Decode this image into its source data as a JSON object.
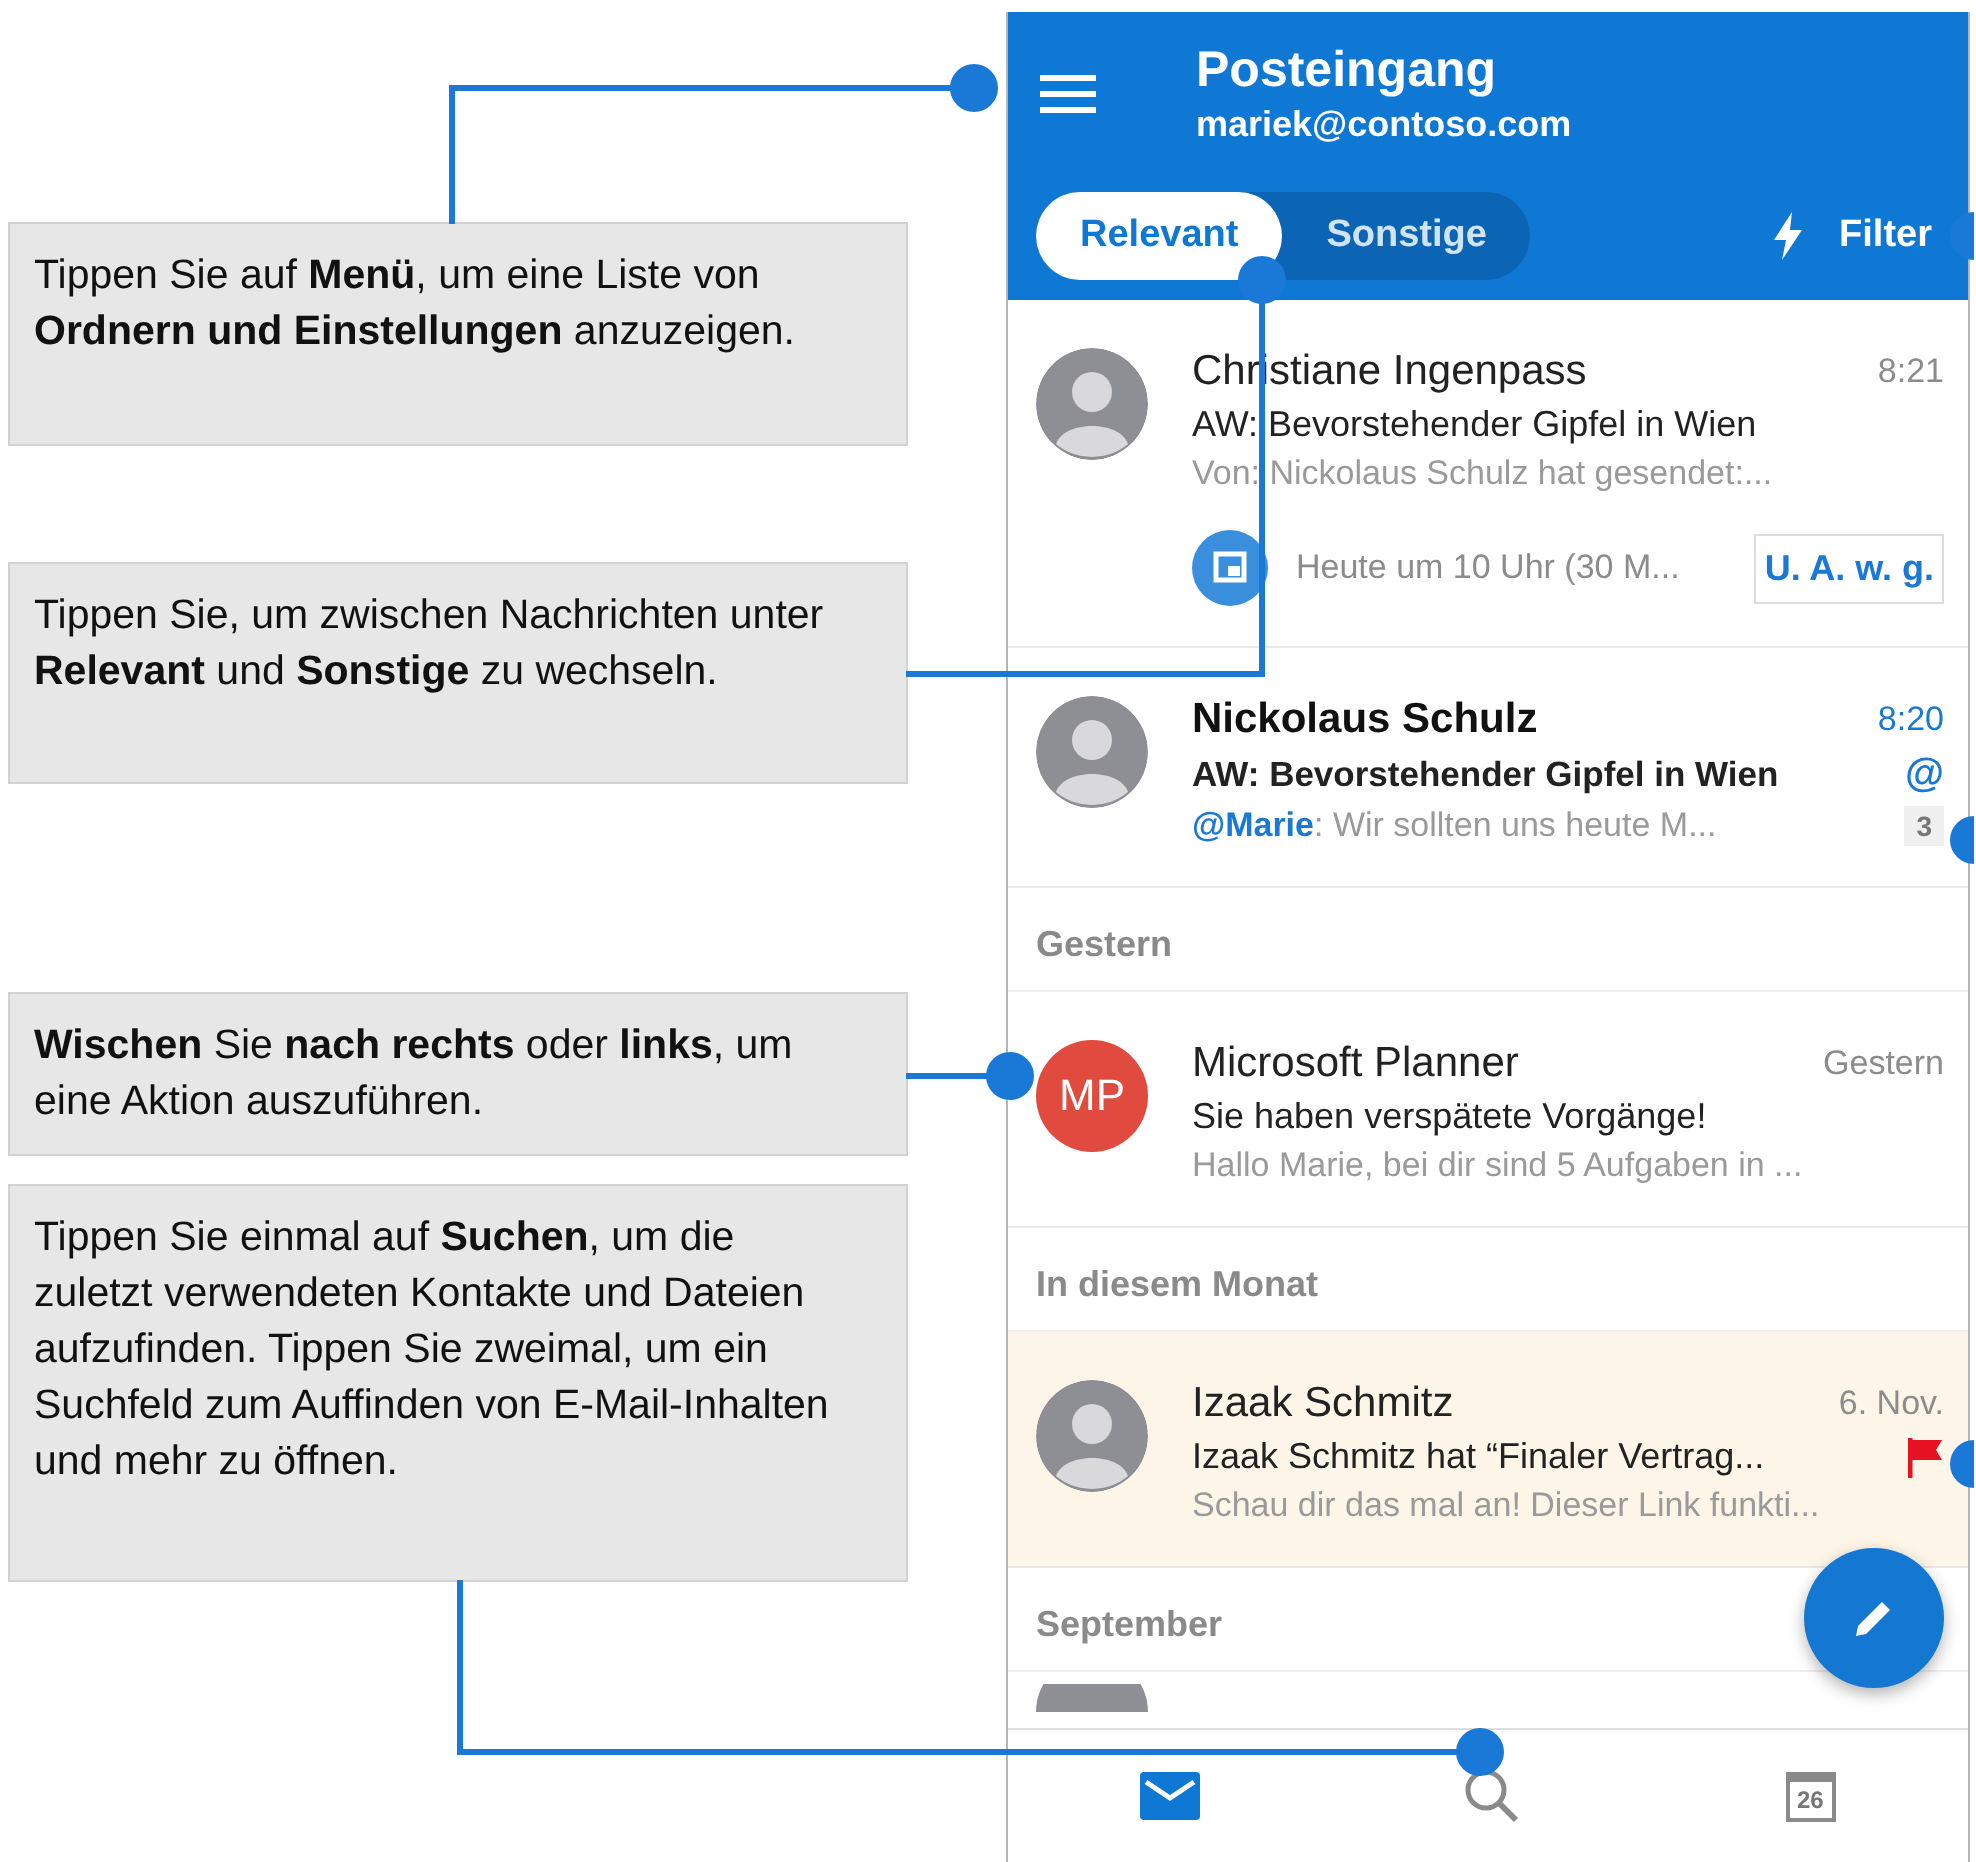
{
  "callouts": [
    {
      "text": "Tippen Sie auf **Menü**, um eine Liste von **Ordnern und Einstellungen** anzuzeigen."
    },
    {
      "text": "Tippen Sie, um zwischen Nachrichten unter **Relevant** und **Sonstige** zu wechseln."
    },
    {
      "text": "**Wischen** Sie **nach rechts** oder **links**, um eine Aktion auszuführen."
    },
    {
      "text": "Tippen Sie einmal auf **Suchen**, um die zuletzt verwendeten Kontakte und Dateien aufzufinden. Tippen Sie zweimal, um ein Suchfeld zum Auffinden von E-Mail-Inhalten und mehr zu öffnen."
    }
  ],
  "header": {
    "title": "Posteingang",
    "account": "mariek@contoso.com",
    "filter": "Filter",
    "tabs": [
      {
        "label": "Relevant",
        "selected": true
      },
      {
        "label": "Sonstige",
        "selected": false
      }
    ]
  },
  "sections": [
    {
      "messages": [
        {
          "sender": "Christiane Ingenpass",
          "time": "8:21",
          "subject": "AW: Bevorstehender Gipfel in Wien",
          "preview": "Von: Nickolaus Schulz hat gesendet:...",
          "unread": false,
          "flagged": false,
          "avatar": {
            "kind": "photo"
          },
          "event": {
            "text": "Heute um 10 Uhr (30 M...",
            "action": "U. A. w. g."
          }
        },
        {
          "sender": "Nickolaus Schulz",
          "time": "8:20",
          "subject": "AW: Bevorstehender Gipfel in Wien",
          "mention": "@Marie",
          "preview": ": Wir sollten uns heute M...",
          "unread": true,
          "flagged": false,
          "at_sign": "@",
          "count": "3",
          "avatar": {
            "kind": "photo"
          }
        }
      ]
    },
    {
      "heading": "Gestern",
      "messages": [
        {
          "sender": "Microsoft Planner",
          "time": "Gestern",
          "subject": "Sie haben verspätete Vorgänge!",
          "preview": "Hallo Marie, bei dir sind 5 Aufgaben in ...",
          "unread": false,
          "flagged": false,
          "avatar": {
            "kind": "initials",
            "initials": "MP",
            "color": "#e04a3f"
          }
        }
      ]
    },
    {
      "heading": "In diesem Monat",
      "messages": [
        {
          "sender": "Izaak Schmitz",
          "time": "6. Nov.",
          "subject": "Izaak Schmitz hat “Finaler Vertrag...",
          "preview": "Schau dir das mal an! Dieser Link funkti...",
          "unread": false,
          "flagged": true,
          "avatar": {
            "kind": "photo"
          }
        }
      ]
    },
    {
      "heading": "September"
    }
  ],
  "bottom_nav": [
    {
      "kind": "mail",
      "selected": true
    },
    {
      "kind": "search",
      "selected": false
    },
    {
      "kind": "calendar",
      "label": "26",
      "selected": false
    }
  ]
}
